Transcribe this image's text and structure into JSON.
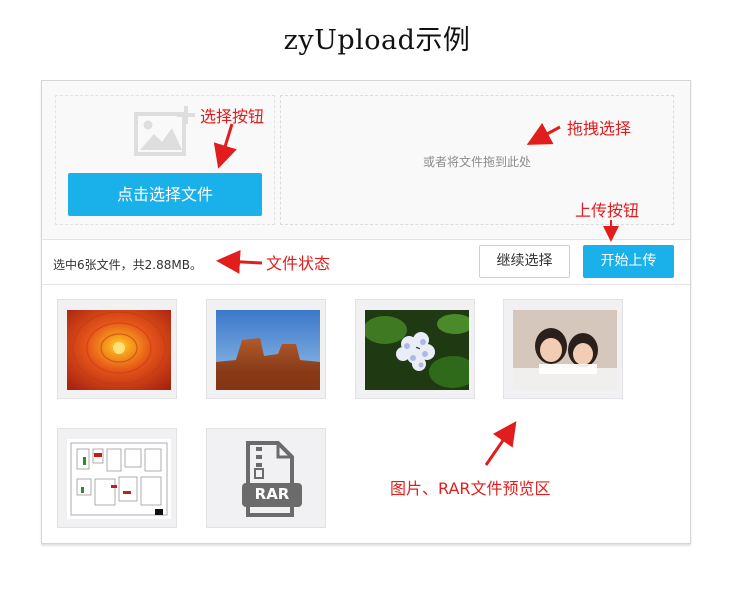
{
  "page": {
    "title": "zyUpload示例"
  },
  "uploader": {
    "select_button_label": "点击选择文件",
    "drop_hint": "或者将文件拖到此处",
    "status_text": "选中6张文件，共2.88MB。",
    "continue_button_label": "继续选择",
    "start_button_label": "开始上传",
    "accent_color": "#1ab0ea"
  },
  "previews": [
    {
      "name": "orange-dahlia-flower",
      "kind": "photo"
    },
    {
      "name": "desert-landscape",
      "kind": "photo"
    },
    {
      "name": "hydrangea-flower",
      "kind": "photo"
    },
    {
      "name": "two-children",
      "kind": "photo"
    },
    {
      "name": "floor-plan-drawing",
      "kind": "photo"
    },
    {
      "name": "rar-archive",
      "kind": "file",
      "label": "RAR"
    }
  ],
  "annotations": {
    "select_button": "选择按钮",
    "drag_select": "拖拽选择",
    "upload_button": "上传按钮",
    "file_status": "文件状态",
    "preview_area": "图片、RAR文件预览区",
    "color": "#e21d1d"
  }
}
